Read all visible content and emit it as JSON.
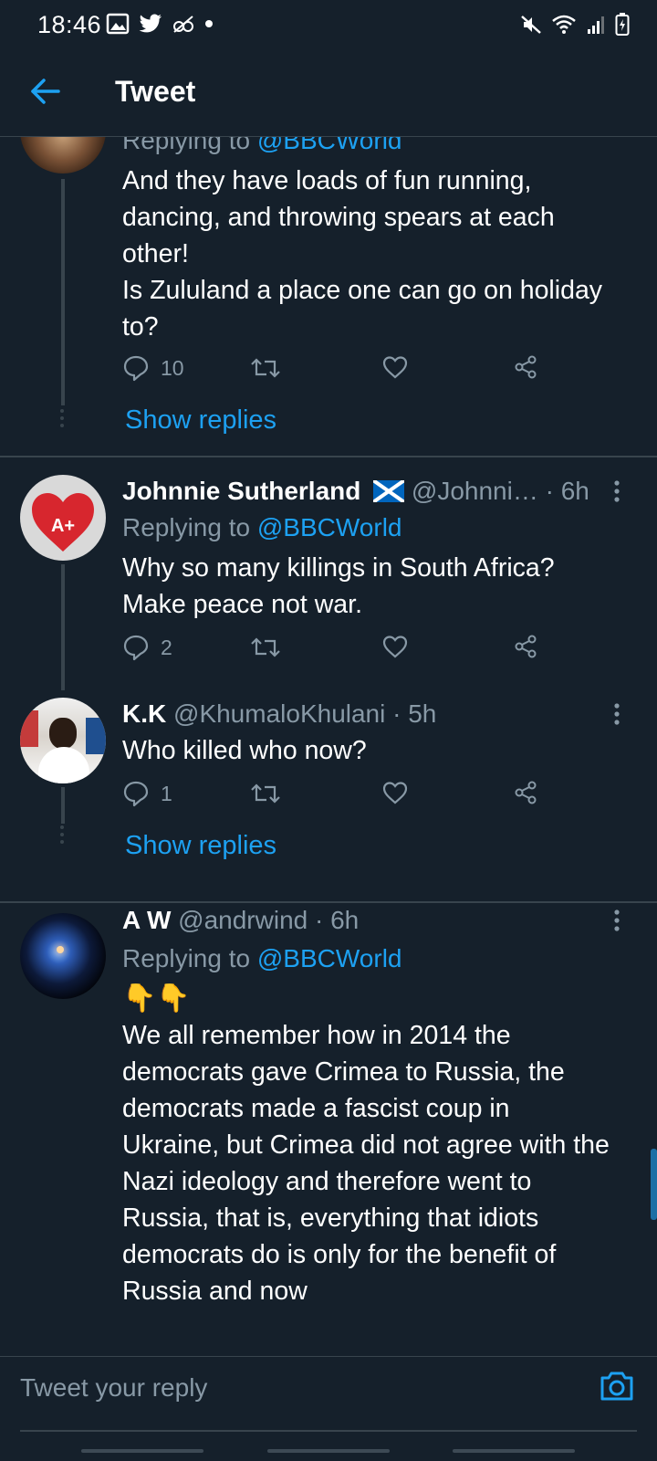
{
  "status": {
    "time": "18:46"
  },
  "header": {
    "title": "Tweet"
  },
  "tweets": [
    {
      "reply_prefix": "Replying to ",
      "mention": "@BBCWorld",
      "lines": [
        "And they have loads of fun running,",
        "dancing, and throwing spears at each",
        "other!",
        "Is Zululand a place one can go on holiday",
        "to?"
      ],
      "reply_count": "10",
      "show_replies": "Show replies"
    },
    {
      "name": "Johnnie Sutherland",
      "handle_time": " @Johnni… · 6h",
      "avatar_label": "A+",
      "reply_prefix": "Replying to ",
      "mention": "@BBCWorld",
      "lines": [
        "Why so many killings in South Africa?",
        "Make peace not war."
      ],
      "reply_count": "2"
    },
    {
      "name": "K.K",
      "handle_time": " @KhumaloKhulani · 5h",
      "lines": [
        "Who killed who now?"
      ],
      "reply_count": "1",
      "show_replies": "Show replies"
    },
    {
      "name": "A W",
      "handle_time": " @andrwind · 6h",
      "reply_prefix": "Replying to ",
      "mention": "@BBCWorld",
      "emoji": "👇👇",
      "lines": [
        "We all remember how in 2014 the",
        "democrats gave Crimea to Russia, the",
        "democrats made a fascist coup in",
        "Ukraine, but Crimea did not agree with the",
        "Nazi ideology and therefore went to",
        "Russia, that is, everything that idiots",
        "democrats do is only for the benefit of",
        "Russia and now"
      ]
    }
  ],
  "reply_bar": {
    "placeholder": "Tweet your reply"
  },
  "colors": {
    "background": "#15202b",
    "accent": "#1da1f2",
    "secondary_text": "#8899a6",
    "divider": "#38444d"
  }
}
